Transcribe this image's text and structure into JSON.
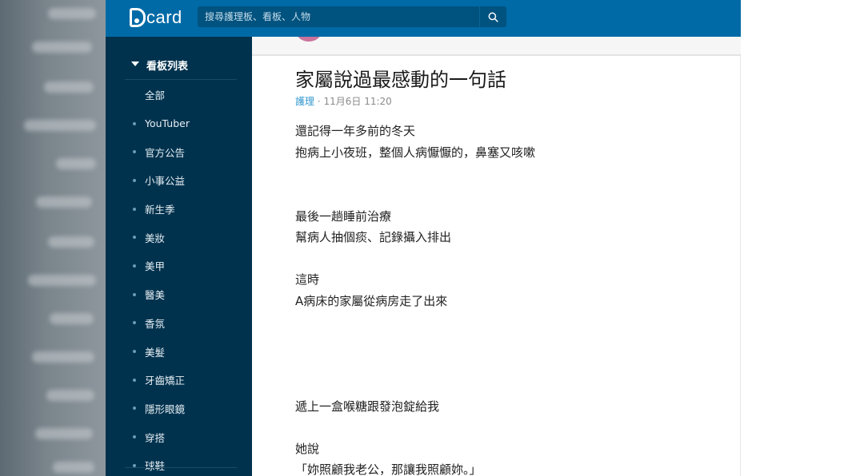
{
  "app": {
    "logo_text": "card",
    "brand_color": "#006aa6"
  },
  "search": {
    "placeholder": "搜尋護理板、看板、人物",
    "icon": "search-icon"
  },
  "sidebar": {
    "header": "看板列表",
    "items": [
      {
        "label": "全部",
        "dot": false
      },
      {
        "label": "YouTuber",
        "dot": true
      },
      {
        "label": "官方公告",
        "dot": true
      },
      {
        "label": "小事公益",
        "dot": true
      },
      {
        "label": "新生季",
        "dot": true
      },
      {
        "label": "美妝",
        "dot": true
      },
      {
        "label": "美甲",
        "dot": true
      },
      {
        "label": "醫美",
        "dot": true
      },
      {
        "label": "香氛",
        "dot": true
      },
      {
        "label": "美髮",
        "dot": true
      },
      {
        "label": "牙齒矯正",
        "dot": true
      },
      {
        "label": "隱形眼鏡",
        "dot": true
      },
      {
        "label": "穿搭",
        "dot": true
      },
      {
        "label": "球鞋",
        "dot": true
      }
    ]
  },
  "post": {
    "title": "家屬說過最感動的一句話",
    "board": "護理",
    "separator": "·",
    "datetime": "11月6日 11:20",
    "lines": [
      "還記得一年多前的冬天",
      "抱病上小夜班，整個人病懨懨的，鼻塞又咳嗽",
      "最後一趟睡前治療",
      "幫病人抽個痰、記錄攝入排出",
      "這時",
      "A病床的家屬從病房走了出來",
      "遞上一盒喉糖跟發泡錠給我",
      "她說",
      "「妳照顧我老公，那讓我照顧妳。」"
    ]
  }
}
